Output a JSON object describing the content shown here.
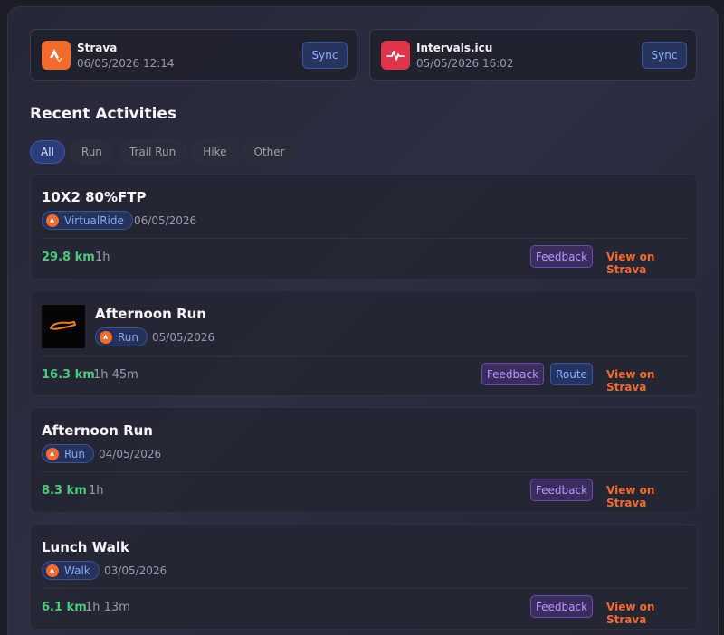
{
  "integrations": [
    {
      "name": "Strava",
      "last_sync": "06/05/2026 12:14",
      "button": "Sync",
      "icon": "strava-logo-icon",
      "color": "#f26b2c"
    },
    {
      "name": "Intervals.icu",
      "last_sync": "05/05/2026 16:02",
      "button": "Sync",
      "icon": "pulse-logo-icon",
      "color": "#e0344a"
    }
  ],
  "section_title": "Recent Activities",
  "filters": [
    "All",
    "Run",
    "Trail Run",
    "Hike",
    "Other"
  ],
  "active_filter": "All",
  "activities": [
    {
      "title": "10X2 80%FTP",
      "type": "VirtualRide",
      "date": "06/05/2026",
      "distance": "29.8 km",
      "duration": "1h",
      "feedback": "Feedback",
      "view": "View on Strava"
    },
    {
      "title": "Afternoon Run",
      "type": "Run",
      "date": "05/05/2026",
      "distance": "16.3 km",
      "duration": "1h 45m",
      "feedback": "Feedback",
      "route": "Route",
      "view": "View on Strava"
    },
    {
      "title": "Afternoon Run",
      "type": "Run",
      "date": "04/05/2026",
      "distance": "8.3 km",
      "duration": "1h",
      "feedback": "Feedback",
      "view": "View on Strava"
    },
    {
      "title": "Lunch Walk",
      "type": "Walk",
      "date": "03/05/2026",
      "distance": "6.1 km",
      "duration": "1h 13m",
      "feedback": "Feedback",
      "view": "View on Strava"
    }
  ],
  "colors": {
    "accent": "#2a3d7a",
    "strava": "#f4692c",
    "distance": "#4cc979",
    "feedback": "#b896ff"
  }
}
